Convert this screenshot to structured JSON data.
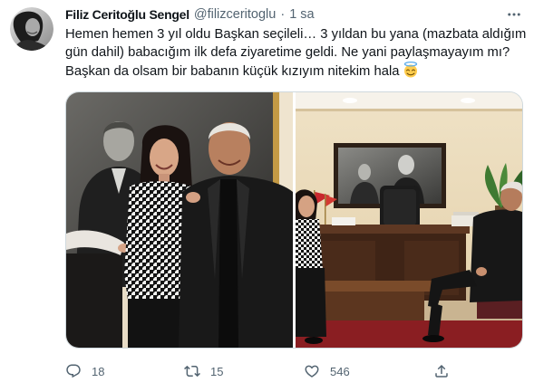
{
  "tweet": {
    "author": {
      "name": "Filiz Ceritoğlu Sengel",
      "handle": "@filizceritoglu",
      "separator": "·",
      "time": "1 sa",
      "avatar_icon": "avatar"
    },
    "more_icon": "more-dots-icon",
    "text_lines": [
      "Hemen hemen 3 yıl oldu Başkan seçileli… 3 yıldan bu yana (mazbata aldığım",
      "gün dahil) babacığım ilk defa ziyaretime geldi. Ne yani paylaşmayayım mı?",
      "Başkan da olsam bir babanın küçük kızıyım nitekim hala"
    ],
    "emoji_icon": "smiling-face-with-halo-icon",
    "actions": {
      "reply": {
        "icon": "reply-icon",
        "count": "18"
      },
      "retweet": {
        "icon": "retweet-icon",
        "count": "15"
      },
      "like": {
        "icon": "heart-icon",
        "count": "546"
      },
      "share": {
        "icon": "share-icon"
      }
    }
  },
  "colors": {
    "text": "#0f1419",
    "secondary": "#536471",
    "border": "#cfd9de",
    "background": "#ffffff"
  }
}
